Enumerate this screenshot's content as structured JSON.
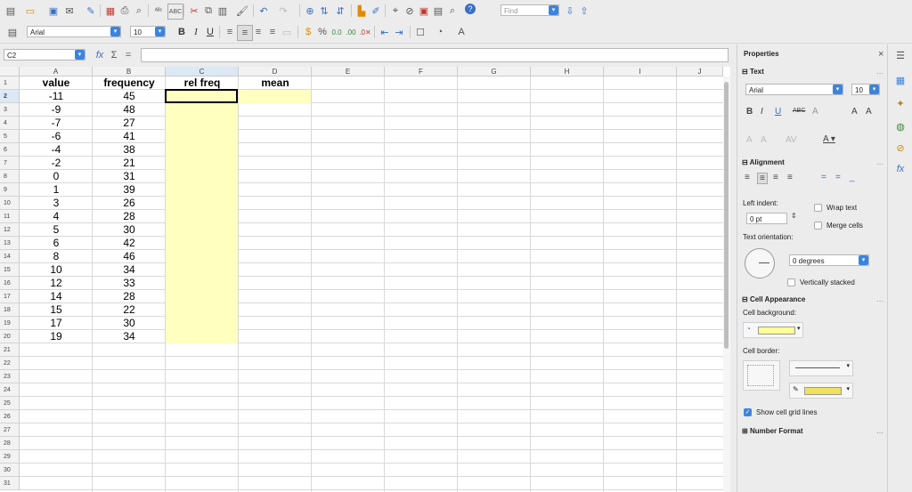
{
  "toolbar": {
    "find_placeholder": "Find",
    "icons": [
      "new-icon",
      "open-icon",
      "save-icon",
      "email-icon",
      "edit-file-icon",
      "export-pdf-icon",
      "print-icon",
      "print-preview-icon",
      "spelling-icon",
      "autospell-icon",
      "cut-icon",
      "copy-icon",
      "paste-icon",
      "clone-format-icon",
      "undo-icon",
      "redo-icon",
      "hyperlink-icon",
      "sort-asc-icon",
      "sort-desc-icon",
      "chart-icon",
      "draw-icon",
      "find-replace-icon",
      "navigator-icon",
      "image-icon",
      "gallery-icon",
      "zoom-icon",
      "help-icon"
    ]
  },
  "format": {
    "font_name": "Arial",
    "font_size": "10",
    "bold": "B",
    "italic": "I",
    "underline": "U"
  },
  "formula_bar": {
    "name_box": "C2",
    "fx": "fx",
    "sum": "Σ",
    "equals": "=",
    "content": ""
  },
  "sheet": {
    "columns": [
      "A",
      "B",
      "C",
      "D",
      "E",
      "F",
      "G",
      "H",
      "I",
      "J"
    ],
    "selected_column": "C",
    "rows": [
      "1",
      "2",
      "3",
      "4",
      "5",
      "6",
      "7",
      "8",
      "9",
      "10",
      "11",
      "12",
      "13",
      "14",
      "15",
      "16",
      "17",
      "18",
      "19",
      "20",
      "21",
      "22",
      "23",
      "24",
      "25",
      "26",
      "27",
      "28",
      "29",
      "30",
      "31"
    ],
    "selected_row": "2",
    "headers": {
      "a": "value",
      "b": "frequency",
      "c": "rel freq",
      "d": "mean"
    },
    "values": [
      "-11",
      "-9",
      "-7",
      "-6",
      "-4",
      "-2",
      "0",
      "1",
      "3",
      "4",
      "5",
      "6",
      "8",
      "10",
      "12",
      "14",
      "15",
      "17",
      "19"
    ],
    "frequencies": [
      "45",
      "48",
      "27",
      "41",
      "38",
      "21",
      "31",
      "39",
      "26",
      "28",
      "30",
      "42",
      "46",
      "34",
      "33",
      "28",
      "22",
      "30",
      "34"
    ],
    "highlight_color": "#ffffc0"
  },
  "sidebar": {
    "title": "Properties",
    "text_section": "Text",
    "font_name": "Arial",
    "font_size": "10",
    "alignment_section": "Alignment",
    "left_indent_label": "Left indent:",
    "left_indent_value": "0 pt",
    "wrap_text": "Wrap text",
    "merge_cells": "Merge cells",
    "text_orientation_label": "Text orientation:",
    "orientation_value": "0 degrees",
    "vertically_stacked": "Vertically stacked",
    "cell_appearance_section": "Cell Appearance",
    "cell_background_label": "Cell background:",
    "cell_border_label": "Cell border:",
    "show_grid_lines": "Show cell grid lines",
    "number_format_section": "Number Format",
    "accent_color": "#3b84e0",
    "background_swatch": "#ffff99"
  },
  "deck_icons": [
    "properties-icon",
    "styles-icon",
    "gallery-icon",
    "navigator-icon",
    "functions-icon"
  ]
}
